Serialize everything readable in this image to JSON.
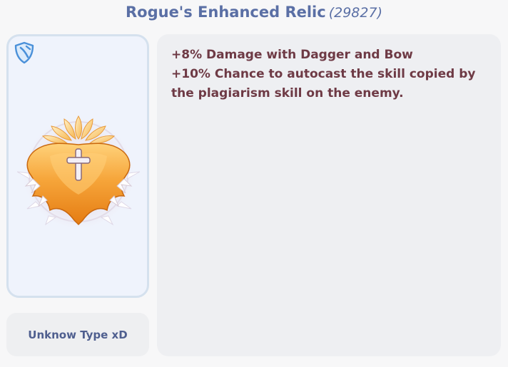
{
  "header": {
    "item_name": "Rogue's Enhanced Relic",
    "item_id": "(29827)"
  },
  "image_panel": {
    "type_icon": "shield-icon"
  },
  "type_label": "Unknow Type xD",
  "description": {
    "lines": [
      "+8% Damage with Dagger and Bow",
      "+10% Chance to autocast the skill copied by the plagiarism skill on the enemy."
    ]
  },
  "colors": {
    "title": "#5a6fa5",
    "description_text": "#6e3a45",
    "type_text": "#4f5f8f",
    "panel_border": "#d5e1ee",
    "icon_blue": "#4a90d9"
  }
}
